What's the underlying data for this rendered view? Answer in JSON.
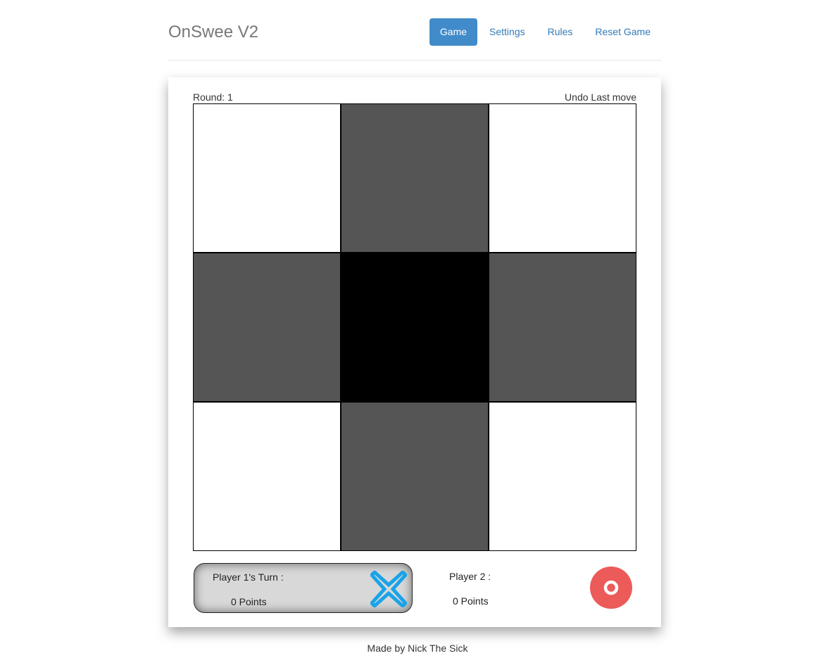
{
  "header": {
    "brand": "OnSwee V2",
    "nav": [
      {
        "label": "Game",
        "active": true
      },
      {
        "label": "Settings",
        "active": false
      },
      {
        "label": "Rules",
        "active": false
      },
      {
        "label": "Reset Game",
        "active": false
      }
    ]
  },
  "game": {
    "round_label": "Round: 1",
    "undo_label": "Undo Last move",
    "board": [
      [
        "white",
        "gray",
        "white"
      ],
      [
        "gray",
        "black",
        "gray"
      ],
      [
        "white",
        "gray",
        "white"
      ]
    ]
  },
  "players": {
    "p1": {
      "label": "Player 1's Turn :",
      "points": "0 Points",
      "icon": "x-icon",
      "color": "#1aa3e8",
      "active": true
    },
    "p2": {
      "label": "Player 2 :",
      "points": "0 Points",
      "icon": "o-icon",
      "color": "#ec5a5a",
      "active": false
    }
  },
  "footer": {
    "text": "Made by Nick The Sick"
  },
  "colors": {
    "nav_active_bg": "#428bca",
    "link": "#337ab7",
    "cell_white": "#ffffff",
    "cell_gray": "#555555",
    "cell_black": "#000000"
  }
}
